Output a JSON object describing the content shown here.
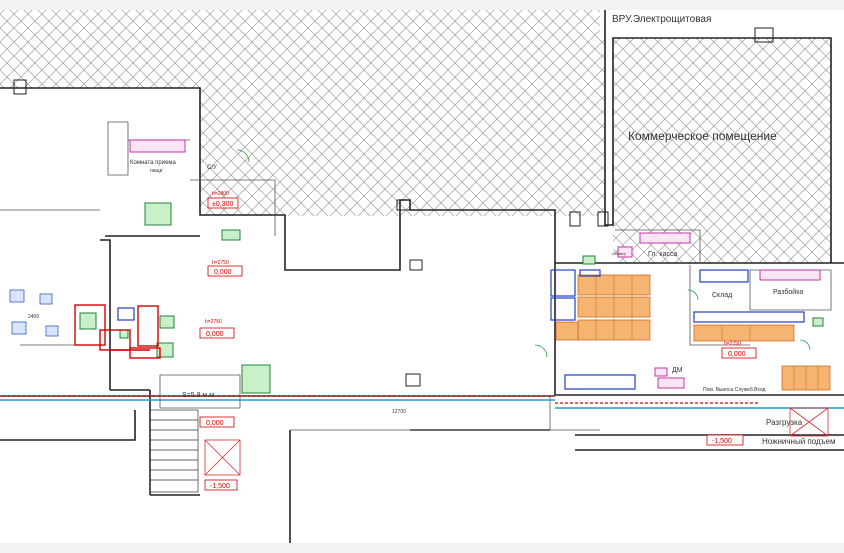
{
  "title": "ВРУ.Электрощитовая",
  "rooms": {
    "commercial": "Коммерческое помещение",
    "break_room": "Комната приема",
    "break_room_sub": "пищи",
    "wc": "С/У",
    "warehouse": "Склад",
    "unpacking": "Разбойка",
    "main_cashier": "Гл. касса",
    "server": "Сервер",
    "security": "ДМ",
    "unloading": "Разгрузка",
    "scissor_lift": "Ножничный подъем",
    "staff_room": "Пом. Выноса Служеб.Вход",
    "area_label": "S=5.8 м.м"
  },
  "levels": [
    {
      "id": "lvl-1",
      "text": "±0,300",
      "h": "h=2800"
    },
    {
      "id": "lvl-2",
      "text": "0,000",
      "h": "h=2750"
    },
    {
      "id": "lvl-3",
      "text": "0,000",
      "h": "h=2750"
    },
    {
      "id": "lvl-4",
      "text": "0,000",
      "h": "h=2750"
    },
    {
      "id": "lvl-5",
      "text": "0,000",
      "h": ""
    },
    {
      "id": "lvl-6",
      "text": "-1,500",
      "h": ""
    },
    {
      "id": "lvl-7",
      "text": "-1,500",
      "h": ""
    }
  ],
  "dims": {
    "d1": "12700",
    "d2": "2400"
  },
  "colors": {
    "wall": "#222222",
    "hatch": "#777777",
    "level_red": "#d40000",
    "orange": "#f0a050",
    "blue": "#2040c0",
    "magenta": "#c020a0",
    "green": "#20a040",
    "cyan": "#20a0d0"
  }
}
